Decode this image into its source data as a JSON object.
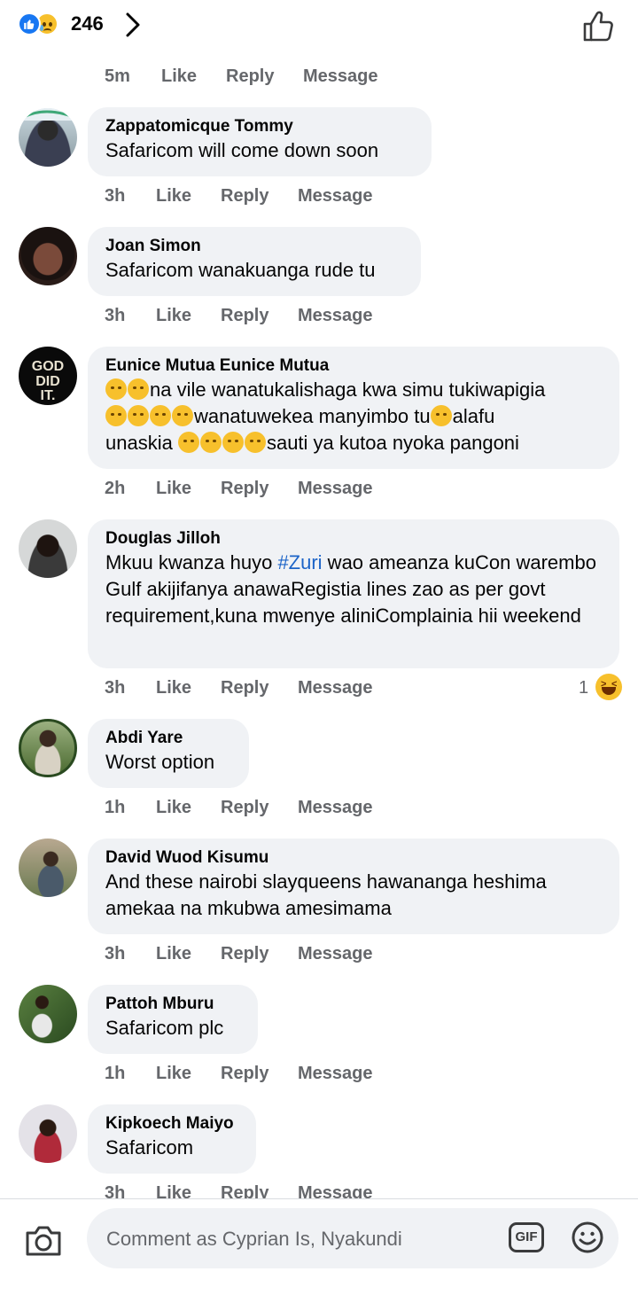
{
  "header": {
    "reaction_count": "246",
    "reaction_icons": [
      "like-icon",
      "sad-icon"
    ],
    "like_icon": "thumbs-up-outline-icon"
  },
  "top_meta": {
    "time": "5m",
    "like": "Like",
    "reply": "Reply",
    "message": "Message"
  },
  "comments": [
    {
      "name": "Zappatomicque Tommy",
      "text": "Safaricom will come down soon",
      "time": "3h",
      "like": "Like",
      "reply": "Reply",
      "message": "Message"
    },
    {
      "name": "Joan Simon",
      "text": "Safaricom wanakuanga rude tu",
      "time": "3h",
      "like": "Like",
      "reply": "Reply",
      "message": "Message"
    },
    {
      "name": "Eunice Mutua Eunice Mutua",
      "text_line1": "na vile wanatukalishaga kwa simu tukiwapigia",
      "text_line2a": "wanatuwekea manyimbo tu",
      "text_line2b": "alafu",
      "text_line3a": "unaskia ",
      "text_line3b": "sauti ya kutoa nyoka pangoni",
      "time": "2h",
      "like": "Like",
      "reply": "Reply",
      "message": "Message"
    },
    {
      "name": "Douglas Jilloh",
      "text_pre": "Mkuu kwanza huyo ",
      "hashtag": "#Zuri",
      "text_post": " wao ameanza kuCon warembo Gulf akijifanya anawaRegistia lines zao as per govt requirement,kuna mwenye aliniComplainia hii weekend",
      "time": "3h",
      "like": "Like",
      "reply": "Reply",
      "message": "Message",
      "reaction_count": "1",
      "reaction": "laugh-icon"
    },
    {
      "name": "Abdi Yare",
      "text": "Worst option",
      "time": "1h",
      "like": "Like",
      "reply": "Reply",
      "message": "Message"
    },
    {
      "name": "David Wuod Kisumu",
      "text": "And these nairobi slayqueens hawananga heshima amekaa na mkubwa amesimama",
      "time": "3h",
      "like": "Like",
      "reply": "Reply",
      "message": "Message"
    },
    {
      "name": "Pattoh Mburu",
      "text": "Safaricom plc",
      "time": "1h",
      "like": "Like",
      "reply": "Reply",
      "message": "Message"
    },
    {
      "name": "Kipkoech Maiyo",
      "text": "Safaricom",
      "time": "3h",
      "like": "Like",
      "reply": "Reply",
      "message": "Message"
    }
  ],
  "composer": {
    "placeholder": "Comment as Cyprian Is, Nyakundi",
    "gif_label": "GIF"
  },
  "colors": {
    "accent": "#1877f2",
    "bubble": "#f0f2f5",
    "meta": "#65676b",
    "hashtag": "#1c64c8"
  }
}
